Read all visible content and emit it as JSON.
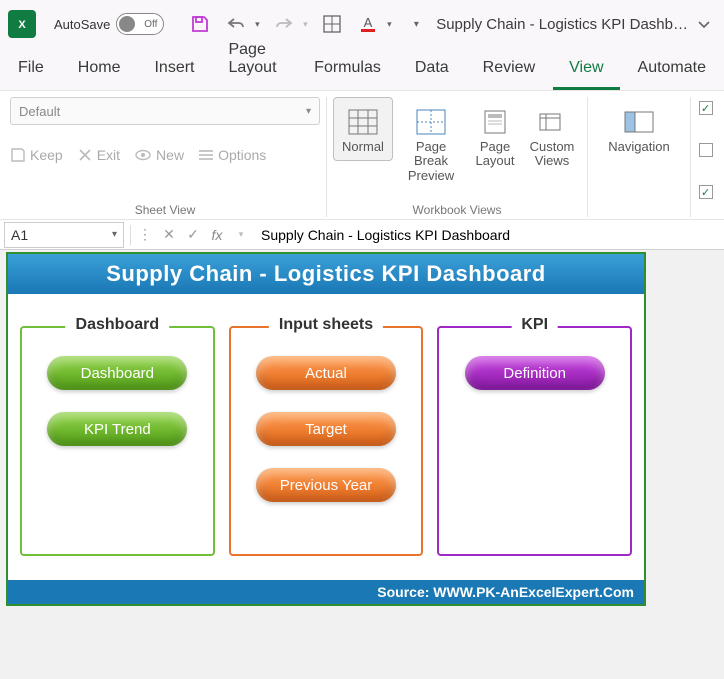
{
  "titlebar": {
    "autosave_label": "AutoSave",
    "autosave_state": "Off",
    "document_title": "Supply Chain - Logistics KPI Dashb…"
  },
  "tabs": [
    "File",
    "Home",
    "Insert",
    "Page Layout",
    "Formulas",
    "Data",
    "Review",
    "View",
    "Automate"
  ],
  "active_tab": "View",
  "ribbon": {
    "sheet_view": {
      "default_label": "Default",
      "keep": "Keep",
      "exit": "Exit",
      "new": "New",
      "options": "Options",
      "group_label": "Sheet View"
    },
    "workbook_views": {
      "normal": "Normal",
      "page_break": "Page Break Preview",
      "page_layout": "Page Layout",
      "custom_views": "Custom Views",
      "group_label": "Workbook Views"
    },
    "navigation": "Navigation"
  },
  "formula_bar": {
    "cell_ref": "A1",
    "formula": "Supply Chain - Logistics KPI Dashboard"
  },
  "dashboard": {
    "title": "Supply Chain - Logistics KPI Dashboard",
    "columns": [
      {
        "title": "Dashboard",
        "color": "green",
        "buttons": [
          "Dashboard",
          "KPI Trend"
        ]
      },
      {
        "title": "Input sheets",
        "color": "orange",
        "buttons": [
          "Actual",
          "Target",
          "Previous Year"
        ]
      },
      {
        "title": "KPI",
        "color": "purple",
        "buttons": [
          "Definition"
        ]
      }
    ],
    "footer": "Source: WWW.PK-AnExcelExpert.Com"
  }
}
